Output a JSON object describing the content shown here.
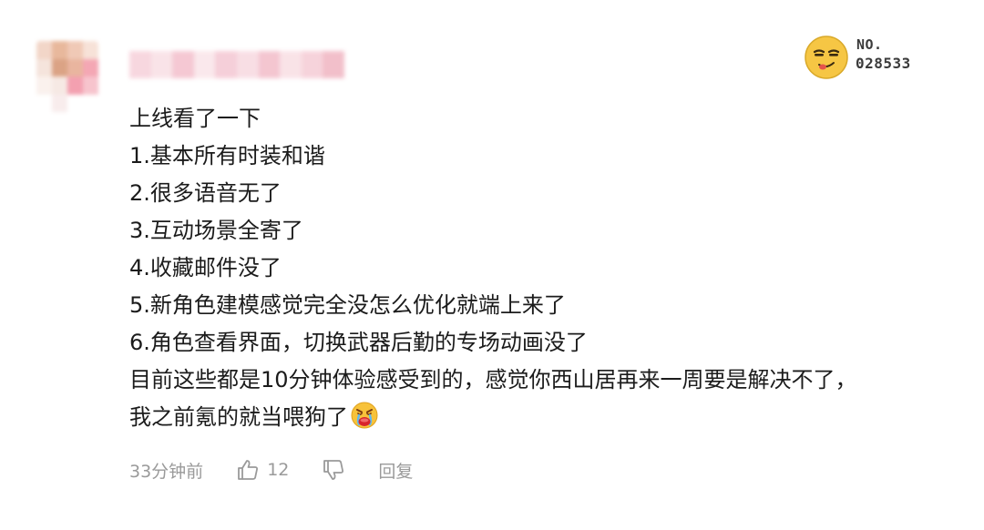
{
  "comment": {
    "lines": [
      "上线看了一下",
      "1.基本所有时装和谐",
      "2.很多语音无了",
      "3.互动场景全寄了",
      "4.收藏邮件没了",
      "5.新角色建模感觉完全没怎么优化就端上来了",
      "6.角色查看界面，切换武器后勤的专场动画没了",
      "目前这些都是10分钟体验感受到的，感觉你西山居再来一周要是解决不了，",
      "我之前氪的就当喂狗了"
    ],
    "trailing_emoji": "angry-crying-emoji"
  },
  "badge": {
    "label": "NO.",
    "number": "028533",
    "icon": "smirking-face-icon"
  },
  "actions": {
    "time": "33分钟前",
    "like_icon": "thumbs-up-icon",
    "like_count": "12",
    "dislike_icon": "thumbs-down-icon",
    "reply_label": "回复"
  },
  "colors": {
    "text": "#1b1b1b",
    "meta": "#9a9a9a",
    "badge_face": "#f6c644"
  }
}
